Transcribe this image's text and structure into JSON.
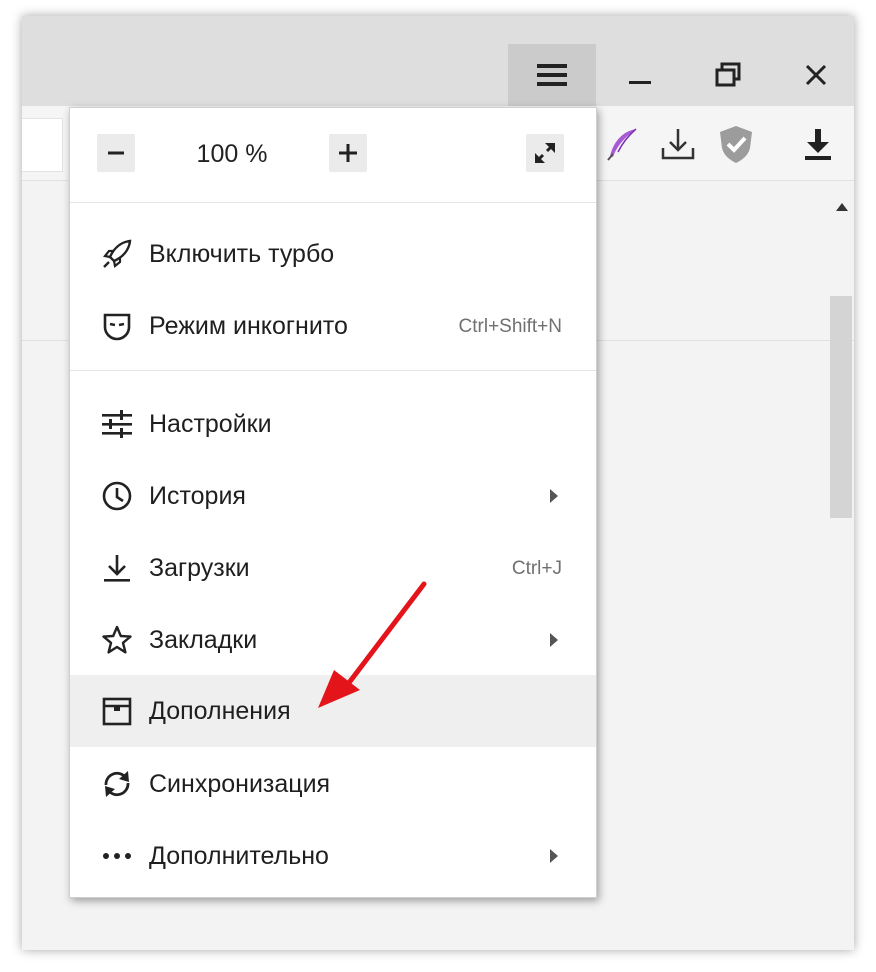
{
  "zoom": {
    "value": "100 %",
    "minus_icon": "minus-icon",
    "plus_icon": "plus-icon",
    "fullscreen_icon": "fullscreen-icon"
  },
  "menu": {
    "items": [
      {
        "label": "Включить турбо",
        "icon": "rocket-icon"
      },
      {
        "label": "Режим инкогнито",
        "shortcut": "Ctrl+Shift+N",
        "icon": "incognito-mask-icon"
      },
      {
        "label": "Настройки",
        "icon": "settings-sliders-icon"
      },
      {
        "label": "История",
        "icon": "clock-icon"
      },
      {
        "label": "Загрузки",
        "shortcut": "Ctrl+J",
        "icon": "download-icon"
      },
      {
        "label": "Закладки",
        "icon": "star-icon"
      },
      {
        "label": "Дополнения",
        "icon": "extensions-box-icon"
      },
      {
        "label": "Синхронизация",
        "icon": "sync-icon"
      },
      {
        "label": "Дополнительно",
        "icon": "more-dots-icon"
      }
    ]
  },
  "colors": {
    "annotation_arrow": "#e3151a",
    "highlight_row": "#efefef",
    "titlebar": "#dedede",
    "menu_button_active": "#cbcbcb"
  }
}
